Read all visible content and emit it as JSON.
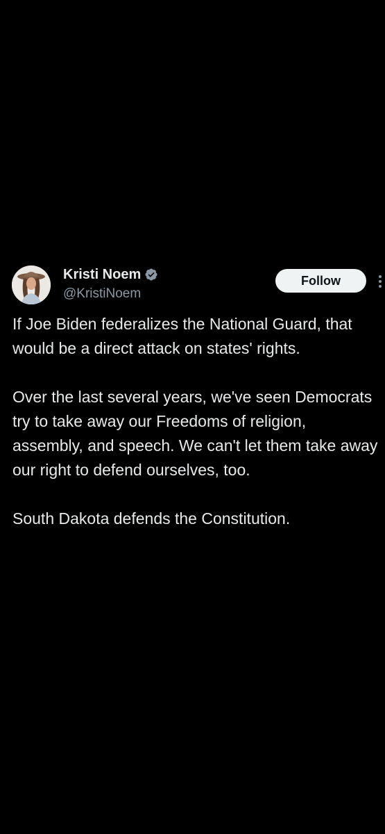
{
  "author": {
    "display_name": "Kristi Noem",
    "handle": "@KristiNoem",
    "verified": true,
    "verified_color": "#8b98a5"
  },
  "actions": {
    "follow_label": "Follow"
  },
  "icons": {
    "verified": "verified-badge-icon",
    "more": "more-vertical-icon"
  },
  "tweet": {
    "paragraphs": [
      "If Joe Biden federalizes the National Guard, that would be a direct attack on states' rights.",
      "Over the last several years, we've seen Democrats try to take away our Freedoms of religion, assembly, and speech. We can't let them take away our right to defend ourselves, too.",
      "South Dakota defends the Constitution."
    ]
  },
  "colors": {
    "background": "#000000",
    "text_primary": "#e7e9ea",
    "text_secondary": "#8b98a5",
    "follow_bg": "#eff3f4",
    "follow_text": "#0f1419"
  }
}
